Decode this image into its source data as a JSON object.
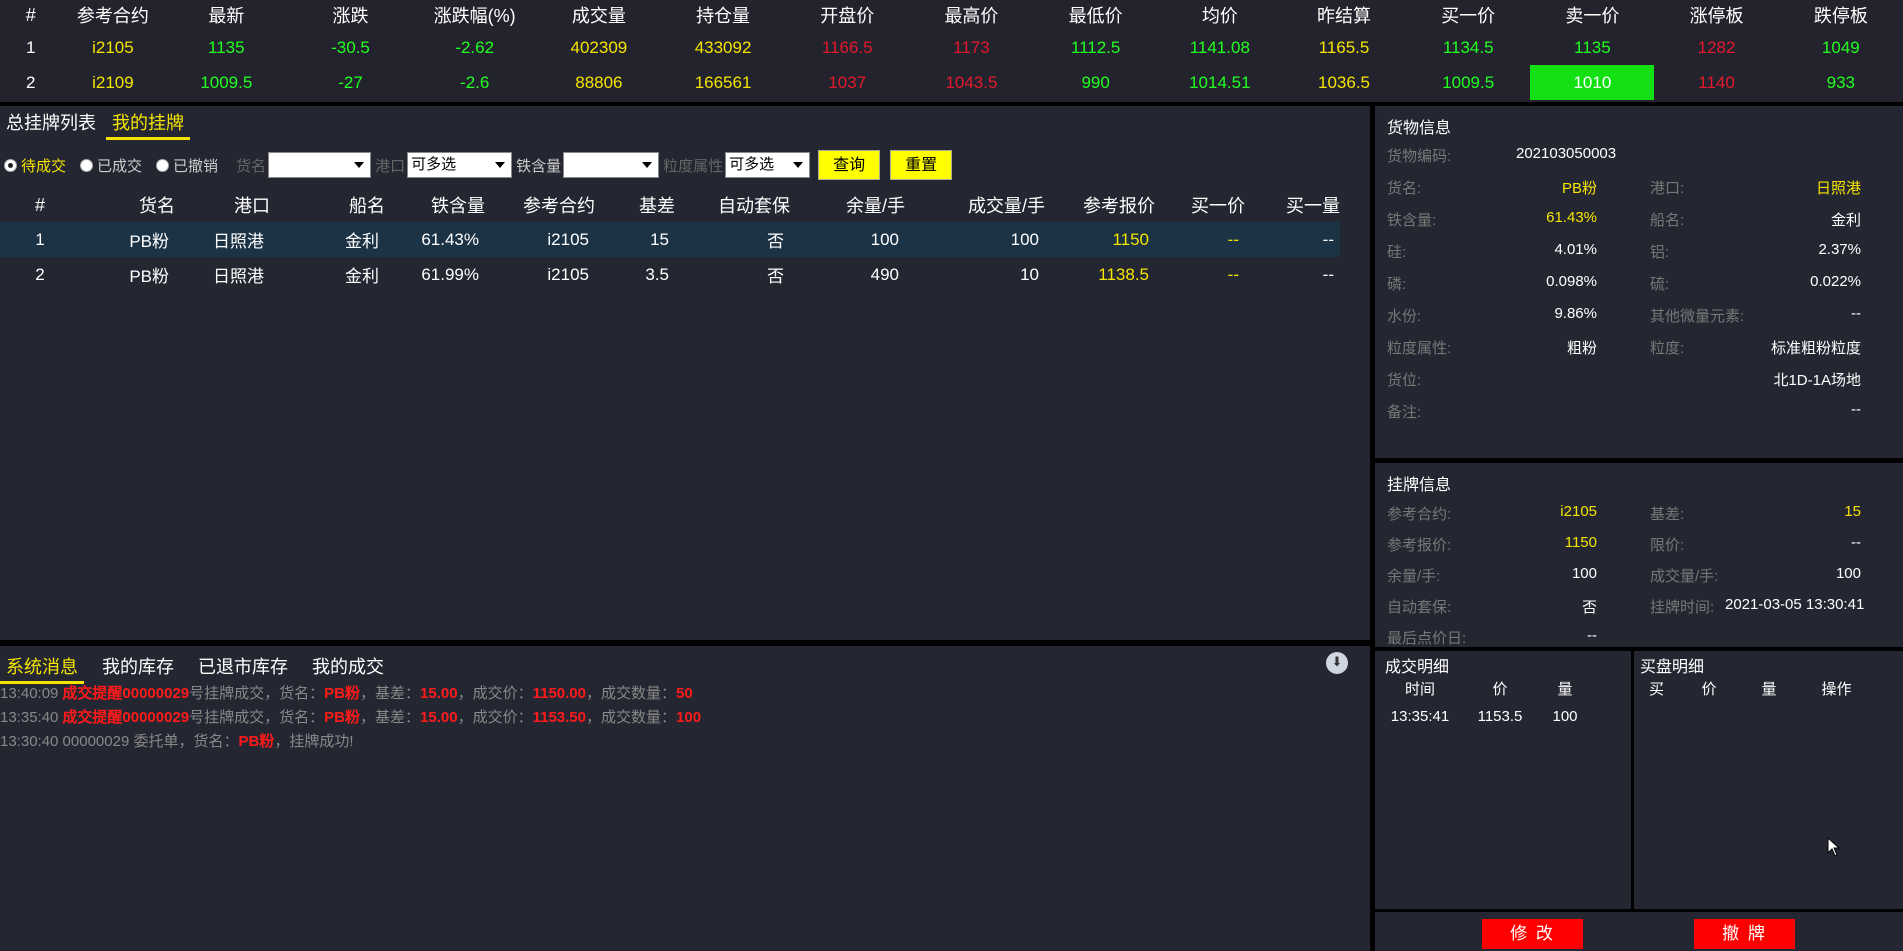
{
  "quote": {
    "headers": [
      "#",
      "参考合约",
      "最新",
      "涨跌",
      "涨跌幅(%)",
      "成交量",
      "持仓量",
      "开盘价",
      "最高价",
      "最低价",
      "均价",
      "昨结算",
      "买一价",
      "卖一价",
      "涨停板",
      "跌停板"
    ],
    "rows": [
      [
        "1",
        "i2105",
        "1135",
        "-30.5",
        "-2.62",
        "402309",
        "433092",
        "1166.5",
        "1173",
        "1112.5",
        "1141.08",
        "1165.5",
        "1134.5",
        "1135",
        "1282",
        "1049"
      ],
      [
        "2",
        "i2109",
        "1009.5",
        "-27",
        "-2.6",
        "88806",
        "166561",
        "1037",
        "1043.5",
        "990",
        "1014.51",
        "1036.5",
        "1009.5",
        "1010",
        "1140",
        "933"
      ]
    ],
    "colors": {
      "white": "#ffffff",
      "yellow": "#f5e400",
      "green": "#21ff21",
      "red": "#e5192d",
      "highlight": "#12e012"
    }
  },
  "orders_panel": {
    "tabs": [
      "总挂牌列表",
      "我的挂牌"
    ],
    "active_tab": "我的挂牌",
    "radios": [
      "待成交",
      "已成交",
      "已撤销"
    ],
    "selected_radio": "待成交",
    "filter_labels": {
      "name": "货名",
      "port": "港口",
      "iron": "铁含量",
      "grain": "粒度属性"
    },
    "port_value": "可多选",
    "grain_value": "可多选",
    "query_label": "查询",
    "reset_label": "重置",
    "headers": [
      "#",
      "货名",
      "港口",
      "船名",
      "铁含量",
      "参考合约",
      "基差",
      "自动套保",
      "余量/手",
      "成交量/手",
      "参考报价",
      "买一价",
      "买一量"
    ],
    "rows": [
      [
        "1",
        "PB粉",
        "日照港",
        "金利",
        "61.43%",
        "i2105",
        "15",
        "否",
        "100",
        "100",
        "1150",
        "--",
        "--"
      ],
      [
        "2",
        "PB粉",
        "日照港",
        "金利",
        "61.99%",
        "i2105",
        "3.5",
        "否",
        "490",
        "10",
        "1138.5",
        "--",
        "--"
      ]
    ]
  },
  "goods": {
    "title": "货物信息",
    "code_label": "货物编码:",
    "code": "202103050003",
    "name_label": "货名:",
    "name": "PB粉",
    "port_label": "港口:",
    "port": "日照港",
    "iron_label": "铁含量:",
    "iron": "61.43%",
    "ship_label": "船名:",
    "ship": "金利",
    "si_label": "硅:",
    "si": "4.01%",
    "al_label": "铝:",
    "al": "2.37%",
    "p_label": "磷:",
    "p": "0.098%",
    "s_label": "硫:",
    "s": "0.022%",
    "water_label": "水份:",
    "water": "9.86%",
    "trace_label": "其他微量元素:",
    "trace": "--",
    "grain_attr_label": "粒度属性:",
    "grain_attr": "粗粉",
    "grain_label": "粒度:",
    "grain": "标准粗粉粒度",
    "location_label": "货位:",
    "location": "北1D-1A场地",
    "remark_label": "备注:",
    "remark": "--"
  },
  "listing": {
    "title": "挂牌信息",
    "contract_label": "参考合约:",
    "contract": "i2105",
    "basis_label": "基差:",
    "basis": "15",
    "ref_price_label": "参考报价:",
    "ref_price": "1150",
    "limit_label": "限价:",
    "limit": "--",
    "remain_label": "余量/手:",
    "remain": "100",
    "deal_label": "成交量/手:",
    "deal": "100",
    "hedge_label": "自动套保:",
    "hedge": "否",
    "time_label": "挂牌时间:",
    "time": "2021-03-05 13:30:41",
    "last_day_label": "最后点价日:",
    "last_day": "--"
  },
  "messages": {
    "tabs": [
      "系统消息",
      "我的库存",
      "已退市库存",
      "我的成交"
    ],
    "active_tab": "系统消息",
    "items": [
      {
        "time": "13:40:09",
        "tag": "成交提醒",
        "no": "00000029",
        "t1": "号挂牌成交，货名：",
        "name": "PB粉",
        "t2": "，基差：",
        "basis": "15.00",
        "t3": "，成交价：",
        "price": "1150.00",
        "t4": "，成交数量：",
        "qty": "50"
      },
      {
        "time": "13:35:40",
        "tag": "成交提醒",
        "no": "00000029",
        "t1": "号挂牌成交，货名：",
        "name": "PB粉",
        "t2": "，基差：",
        "basis": "15.00",
        "t3": "，成交价：",
        "price": "1153.50",
        "t4": "，成交数量：",
        "qty": "100"
      }
    ],
    "plain": {
      "prefix": "13:30:40 00000029 委托单，货名：",
      "name": "PB粉",
      "suffix": "，挂牌成功!"
    }
  },
  "deal_detail": {
    "title": "成交明细",
    "headers": [
      "时间",
      "价",
      "量"
    ],
    "rows": [
      [
        "13:35:41",
        "1153.5",
        "100"
      ]
    ]
  },
  "buy_detail": {
    "title": "买盘明细",
    "headers": [
      "买",
      "价",
      "量",
      "操作"
    ]
  },
  "buttons": {
    "modify": "修 改",
    "withdraw": "撤 牌"
  }
}
